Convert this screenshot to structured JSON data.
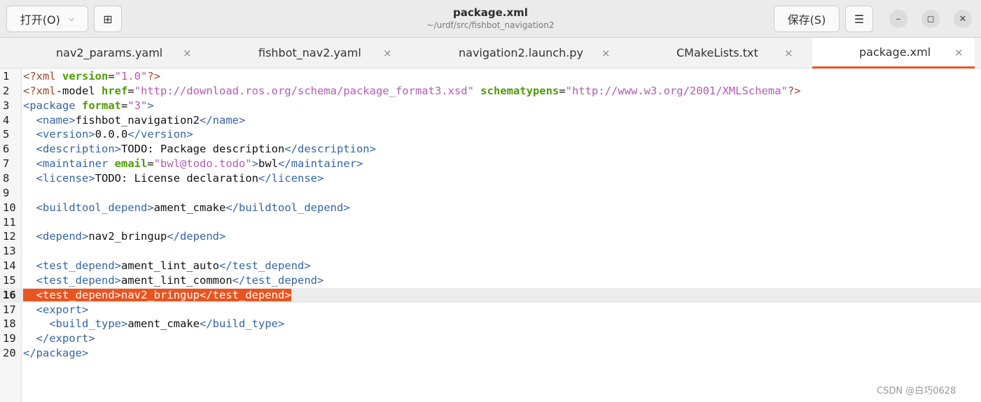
{
  "header": {
    "open_label": "打开(O)",
    "open_chevron": "⌵",
    "new_tab_icon": "⊞",
    "title": "package.xml",
    "subtitle": "~/urdf/src/fishbot_navigation2",
    "save_label": "保存(S)",
    "menu_icon": "☰",
    "minimize_icon": "–",
    "maximize_icon": "◻",
    "close_icon": "✕"
  },
  "tabs": [
    {
      "label": "nav2_params.yaml",
      "close": "×"
    },
    {
      "label": "fishbot_nav2.yaml",
      "close": "×"
    },
    {
      "label": "navigation2.launch.py",
      "close": "×"
    },
    {
      "label": "CMakeLists.txt",
      "close": "×"
    },
    {
      "label": "package.xml",
      "close": "×",
      "active": true
    }
  ],
  "editor": {
    "current_line": 16,
    "lines": [
      {
        "n": "1",
        "text": "<?xml version=\"1.0\"?>"
      },
      {
        "n": "2",
        "text": "<?xml-model href=\"http://download.ros.org/schema/package_format3.xsd\" schematypens=\"http://www.w3.org/2001/XMLSchema\"?>"
      },
      {
        "n": "3",
        "text": "<package format=\"3\">"
      },
      {
        "n": "4",
        "text": "  <name>fishbot_navigation2</name>"
      },
      {
        "n": "5",
        "text": "  <version>0.0.0</version>"
      },
      {
        "n": "6",
        "text": "  <description>TODO: Package description</description>"
      },
      {
        "n": "7",
        "text": "  <maintainer email=\"bwl@todo.todo\">bwl</maintainer>"
      },
      {
        "n": "8",
        "text": "  <license>TODO: License declaration</license>"
      },
      {
        "n": "9",
        "text": ""
      },
      {
        "n": "10",
        "text": "  <buildtool_depend>ament_cmake</buildtool_depend>"
      },
      {
        "n": "11",
        "text": ""
      },
      {
        "n": "12",
        "text": "  <depend>nav2_bringup</depend>"
      },
      {
        "n": "13",
        "text": ""
      },
      {
        "n": "14",
        "text": "  <test_depend>ament_lint_auto</test_depend>"
      },
      {
        "n": "15",
        "text": "  <test_depend>ament_lint_common</test_depend>"
      },
      {
        "n": "16",
        "text": "  <test_depend>nav2_bringup</test_depend>"
      },
      {
        "n": "17",
        "text": "  <export>"
      },
      {
        "n": "18",
        "text": "    <build_type>ament_cmake</build_type>"
      },
      {
        "n": "19",
        "text": "  </export>"
      },
      {
        "n": "20",
        "text": "</package>"
      }
    ]
  },
  "watermark": "CSDN @白巧0628",
  "colors": {
    "accent": "#e95420",
    "tag": "#3465a4",
    "attribute": "#4e9a06",
    "string": "#b45ab4"
  }
}
